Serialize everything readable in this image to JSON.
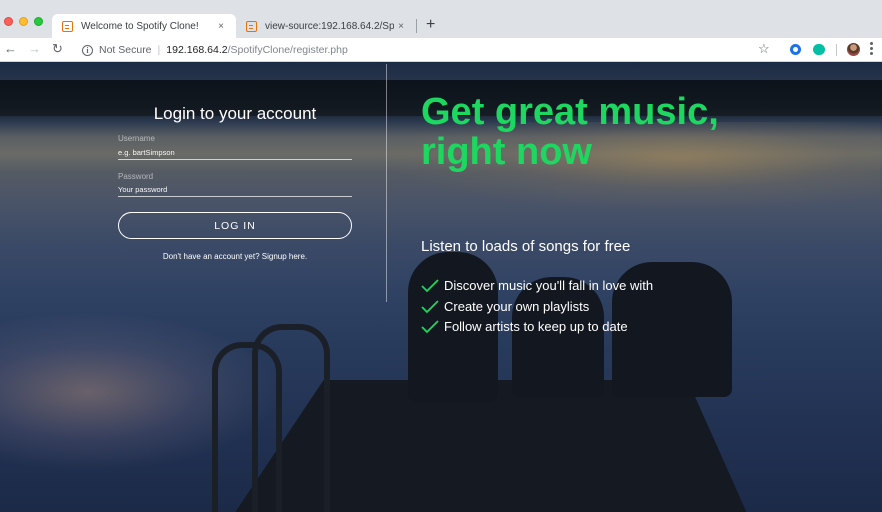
{
  "browser": {
    "tabs": [
      {
        "title": "Welcome to Spotify Clone!",
        "active": true,
        "favicon": "html-file-icon"
      },
      {
        "title": "view-source:192.168.64.2/Spo",
        "active": false,
        "favicon": "html-file-icon"
      }
    ],
    "new_tab_label": "+",
    "close_label": "×",
    "security_label": "Not Secure",
    "url_host": "192.168.64.2",
    "url_path": "/SpotifyClone/register.php"
  },
  "login": {
    "title": "Login to your account",
    "username_label": "Username",
    "username_placeholder": "e.g. bartSimpson",
    "password_label": "Password",
    "password_placeholder": "Your password",
    "button_label": "LOG IN",
    "signup_text": "Don't have an account yet? Signup here."
  },
  "hero": {
    "headline": "Get great music, right now",
    "subheading": "Listen to loads of songs for free",
    "features": [
      "Discover music you'll fall in love with",
      "Create your own playlists",
      "Follow artists to keep up to date"
    ],
    "accent_color": "#1ed760",
    "check_color": "#1ed760"
  }
}
